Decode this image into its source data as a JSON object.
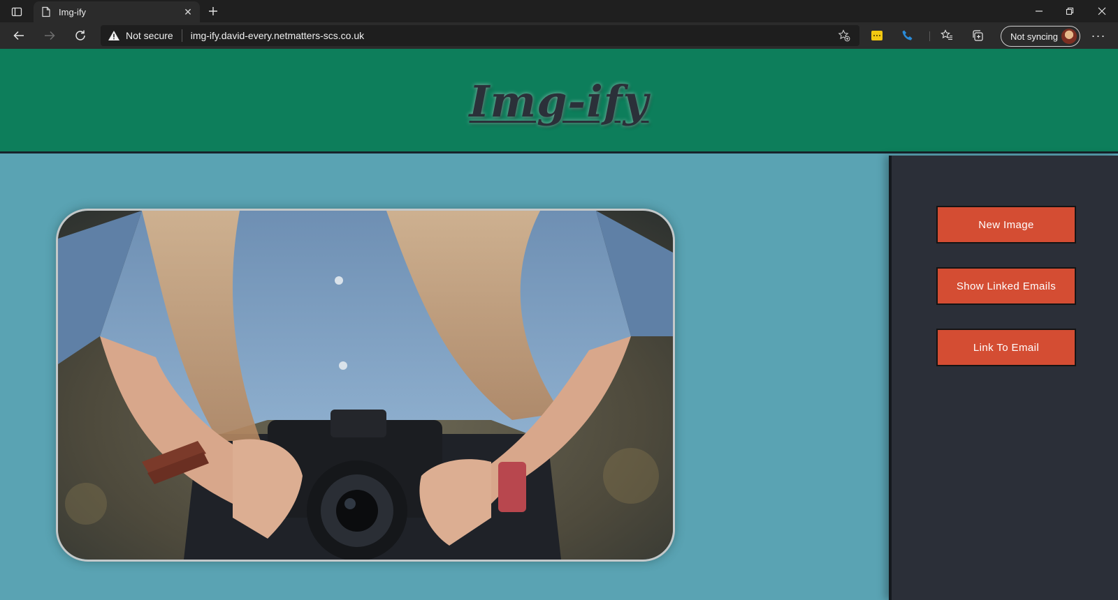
{
  "browser": {
    "tab_title": "Img-ify",
    "security_label": "Not secure",
    "url": "img-ify.david-every.netmatters-scs.co.uk",
    "profile_label": "Not syncing",
    "icons": {
      "tab_actions": "tab-actions-icon",
      "page": "page-icon",
      "close_tab": "close-icon",
      "new_tab": "plus-icon",
      "minimize": "minimize-icon",
      "restore": "restore-icon",
      "close_window": "close-icon",
      "back": "arrow-left-icon",
      "forward": "arrow-right-icon",
      "refresh": "refresh-icon",
      "warning": "warning-icon",
      "add_favorite": "star-plus-icon",
      "favorites": "favorites-icon",
      "collections": "collections-icon",
      "more": "more-icon"
    }
  },
  "site": {
    "logo_text": "Img-ify",
    "colors": {
      "header_bg": "#0d7e5b",
      "content_bg": "#5aa3b3",
      "sidebar_bg": "#2b2f38",
      "button_bg": "#d44d33"
    }
  },
  "sidebar": {
    "buttons": [
      {
        "label": "New Image"
      },
      {
        "label": "Show Linked Emails"
      },
      {
        "label": "Link To Email"
      }
    ]
  }
}
